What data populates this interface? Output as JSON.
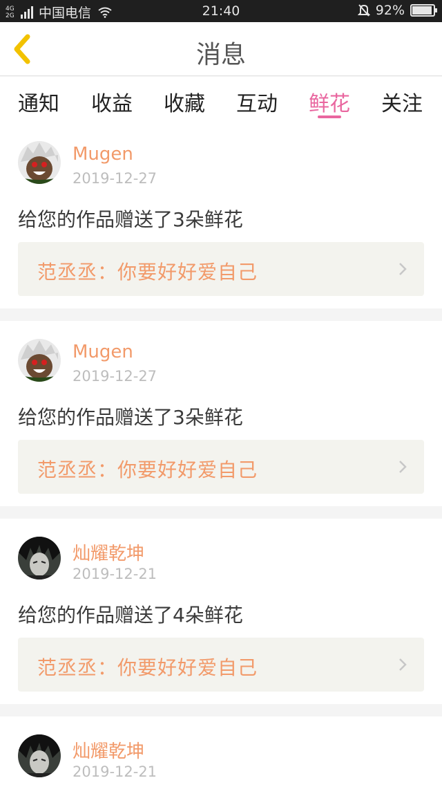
{
  "status_bar": {
    "network_type_top": "4G",
    "network_type_bottom": "2G",
    "carrier": "中国电信",
    "time": "21:40",
    "battery": "92%",
    "battery_level": 0.92
  },
  "header": {
    "title": "消息",
    "back_icon": "chevron-left-icon"
  },
  "tabs": [
    {
      "label": "通知"
    },
    {
      "label": "收益"
    },
    {
      "label": "收藏"
    },
    {
      "label": "互动"
    },
    {
      "label": "鲜花"
    },
    {
      "label": "关注"
    }
  ],
  "active_tab": "鲜花",
  "colors": {
    "accent": "#e9669f",
    "name": "#f29a6a",
    "reply_bg": "#f3f3ee",
    "back_icon": "#f2c200"
  },
  "messages": [
    {
      "user": "Mugen",
      "date": "2019-12-27",
      "text": "给您的作品赠送了3朵鲜花",
      "reply": "范丞丞：你要好好爱自己"
    },
    {
      "user": "Mugen",
      "date": "2019-12-27",
      "text": "给您的作品赠送了3朵鲜花",
      "reply": "范丞丞：你要好好爱自己"
    },
    {
      "user": "灿耀乾坤",
      "date": "2019-12-21",
      "text": "给您的作品赠送了4朵鲜花",
      "reply": "范丞丞：你要好好爱自己"
    },
    {
      "user": "灿耀乾坤",
      "date": "2019-12-21"
    }
  ]
}
